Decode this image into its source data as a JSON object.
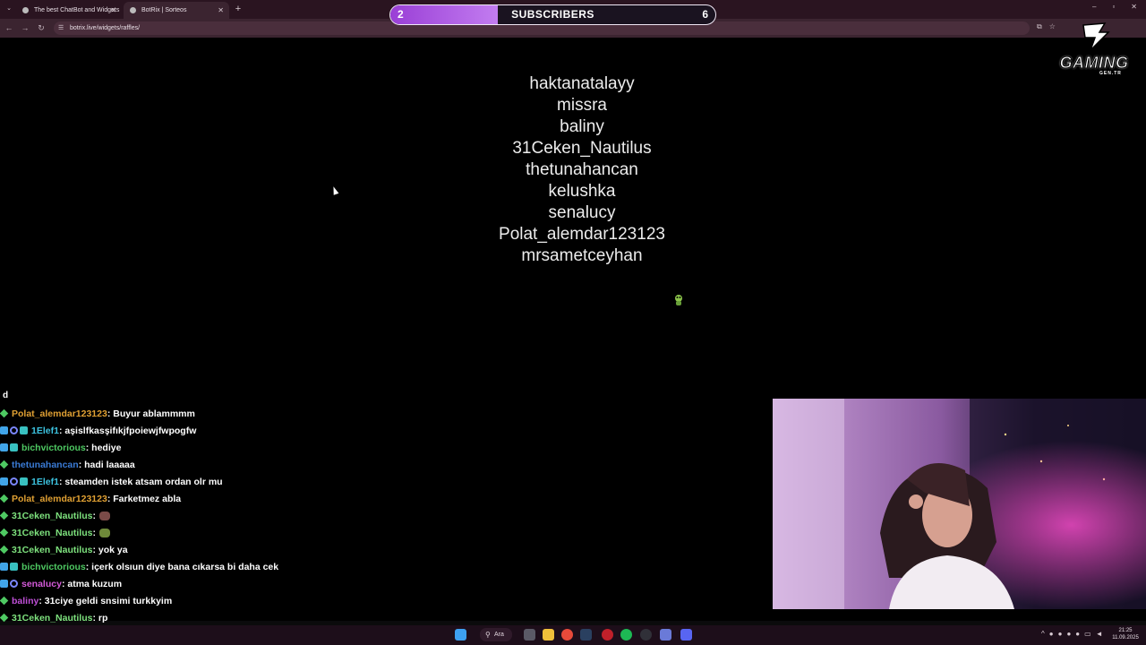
{
  "browser": {
    "tabs": [
      {
        "title": "The best ChatBot and Widgets",
        "active": false
      },
      {
        "title": "BotRix | Sorteos",
        "active": true
      }
    ],
    "url": "botrix.live/widgets/raffles/"
  },
  "subscribers": {
    "current": "2",
    "label": "SUBSCRIBERS",
    "goal": "6",
    "progress": 0.33
  },
  "logo": {
    "word": "GAMING",
    "sub": "GEN.TR"
  },
  "raffle": {
    "names": [
      "haktanatalayy",
      "missra",
      "baliny",
      "31Ceken_Nautilus",
      "thetunahancan",
      "kelushka",
      "senalucy",
      "Polat_alemdar123123",
      "mrsametceyhan"
    ]
  },
  "chat": {
    "stub": "d",
    "messages": [
      {
        "user": "Polat_alemdar123123",
        "color": "#e0a033",
        "badges": [
          "dia"
        ],
        "text": " : Buyur ablammmm"
      },
      {
        "user": "1Elef1",
        "color": "#3cc3e0",
        "badges": [
          "blue",
          "ring",
          "teal"
        ],
        "text": " : aşislfkasşifıkjfpoiewjfwpogfw"
      },
      {
        "user": "bichvictorious",
        "color": "#4ec962",
        "badges": [
          "blue",
          "teal"
        ],
        "text": " : hediye"
      },
      {
        "user": "thetunahancan",
        "color": "#3a7bd5",
        "badges": [
          "dia"
        ],
        "text": " : hadi laaaaa"
      },
      {
        "user": "1Elef1",
        "color": "#3cc3e0",
        "badges": [
          "blue",
          "ring",
          "teal"
        ],
        "text": " : steamden istek atsam ordan olr mu"
      },
      {
        "user": "Polat_alemdar123123",
        "color": "#e0a033",
        "badges": [
          "dia"
        ],
        "text": " : Farketmez abla"
      },
      {
        "user": "31Ceken_Nautilus",
        "color": "#7ee27e",
        "badges": [
          "dia"
        ],
        "text": " :",
        "emote": "#7a4b48"
      },
      {
        "user": "31Ceken_Nautilus",
        "color": "#7ee27e",
        "badges": [
          "dia"
        ],
        "text": " :",
        "emote": "#6f8a3a"
      },
      {
        "user": "31Ceken_Nautilus",
        "color": "#7ee27e",
        "badges": [
          "dia"
        ],
        "text": " : yok ya"
      },
      {
        "user": "bichvictorious",
        "color": "#4ec962",
        "badges": [
          "blue",
          "teal"
        ],
        "text": " : içerk olsıun diye bana cıkarsa bi daha cek"
      },
      {
        "user": "senalucy",
        "color": "#d35ad8",
        "badges": [
          "blue",
          "ring"
        ],
        "text": " : atma kuzum"
      },
      {
        "user": "baliny",
        "color": "#c050d8",
        "badges": [
          "dia"
        ],
        "text": " : 31ciye geldi snsimi turkkyim"
      },
      {
        "user": "31Ceken_Nautilus",
        "color": "#7ee27e",
        "badges": [
          "dia"
        ],
        "text": " : rp"
      },
      {
        "user": "31Ceken_Nautilus",
        "color": "#7ee27e",
        "badges": [
          "dia"
        ],
        "text": " :",
        "emote": "#8bc34a"
      }
    ]
  },
  "taskbar": {
    "search_label": "Ara",
    "time": "21:25",
    "date": "11.09.2025"
  }
}
